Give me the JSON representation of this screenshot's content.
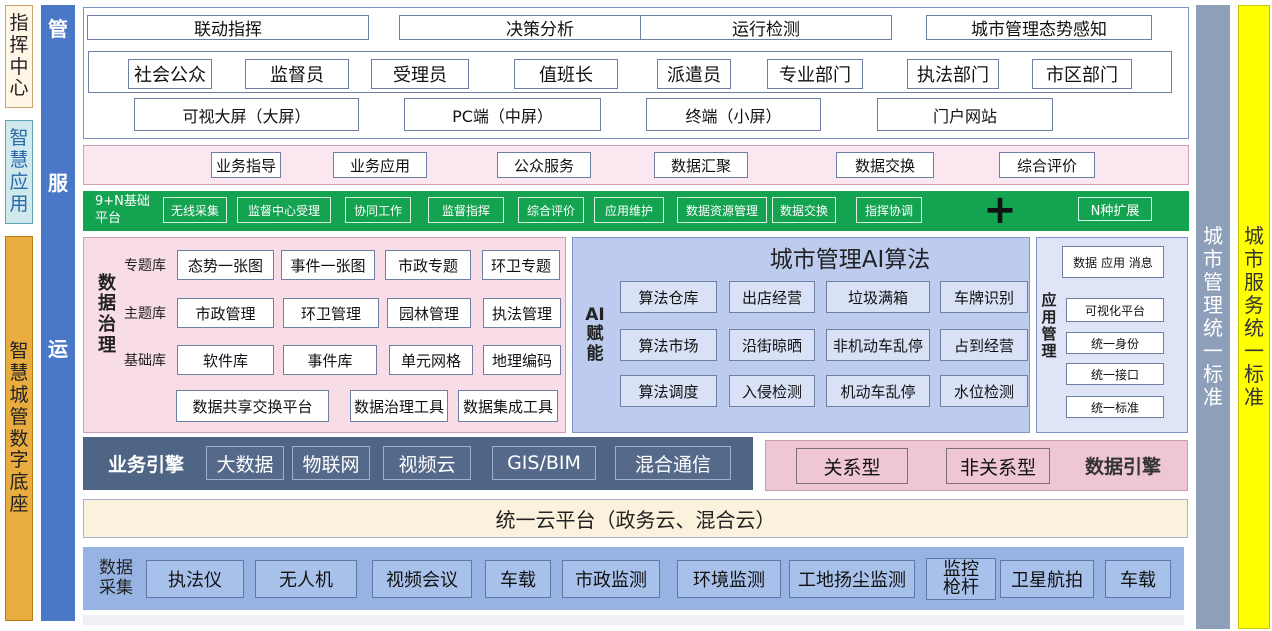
{
  "side": {
    "command": "指挥中心",
    "smart_app": "智慧应用",
    "base": "智慧城管数字底座",
    "mgmt_std": "城市管理统一标准",
    "svc_std": "城市服务统一标准",
    "guan": "管",
    "fu": "服",
    "yun": "运"
  },
  "top": {
    "row1": [
      "联动指挥",
      "决策分析",
      "运行检测",
      "城市管理态势感知"
    ],
    "row2": [
      "社会公众",
      "监督员",
      "受理员",
      "值班长",
      "派遣员",
      "专业部门",
      "执法部门",
      "市区部门"
    ],
    "row3": [
      "可视大屏（大屏）",
      "PC端（中屏）",
      "终端（小屏）",
      "门户网站"
    ]
  },
  "services": [
    "业务指导",
    "业务应用",
    "公众服务",
    "数据汇聚",
    "数据交换",
    "综合评价"
  ],
  "platform": {
    "title": "9+N基础平台",
    "items": [
      "无线采集",
      "监督中心受理",
      "协同工作",
      "监督指挥",
      "综合评价",
      "应用维护",
      "数据资源管理",
      "数据交换",
      "指挥协调"
    ],
    "plus": "+",
    "ext": "N种扩展"
  },
  "governance": {
    "title": "数据治理",
    "rows": [
      {
        "label": "专题库",
        "items": [
          "态势一张图",
          "事件一张图",
          "市政专题",
          "环卫专题"
        ]
      },
      {
        "label": "主题库",
        "items": [
          "市政管理",
          "环卫管理",
          "园林管理",
          "执法管理"
        ]
      },
      {
        "label": "基础库",
        "items": [
          "软件库",
          "事件库",
          "单元网格",
          "地理编码"
        ]
      }
    ],
    "bottom": [
      "数据共享交换平台",
      "数据治理工具",
      "数据集成工具"
    ]
  },
  "ai": {
    "title": "城市管理AI算法",
    "side": "AI赋能",
    "rows": [
      [
        "算法仓库",
        "出店经营",
        "垃圾满箱",
        "车牌识别"
      ],
      [
        "算法市场",
        "沿街晾晒",
        "非机动车乱停",
        "占到经营"
      ],
      [
        "算法调度",
        "入侵检测",
        "机动车乱停",
        "水位检测"
      ]
    ]
  },
  "appmgmt": {
    "title": "应用管理",
    "items": [
      "数据  应用  消息",
      "可视化平台",
      "统一身份",
      "统一接口",
      "统一标准"
    ]
  },
  "engine": {
    "biz_title": "业务引擎",
    "biz_items": [
      "大数据",
      "物联网",
      "视频云",
      "GIS/BIM",
      "混合通信"
    ],
    "data_items": [
      "关系型",
      "非关系型"
    ],
    "data_title": "数据引擎"
  },
  "cloud": "统一云平台（政务云、混合云）",
  "collect": {
    "title": "数据采集",
    "items": [
      "执法仪",
      "无人机",
      "视频会议",
      "车载",
      "市政监测",
      "环境监测",
      "工地扬尘监测",
      "监控枪杆",
      "卫星航拍",
      "车载"
    ]
  },
  "colors": {
    "blue_bar": "#4a78c8",
    "platform_green": "#14a350",
    "gov_pink": "#f9dde6",
    "ai_blue": "#bccbee",
    "engine_dark": "#4f6586",
    "data_engine_pink": "#efc6d4",
    "cloud_cream": "#fbf2dd",
    "collect_blue": "#97b3e3",
    "mgmt_gray": "#8e9fba",
    "svc_yellow": "#ffff00",
    "gold": "#e9ad3f"
  }
}
